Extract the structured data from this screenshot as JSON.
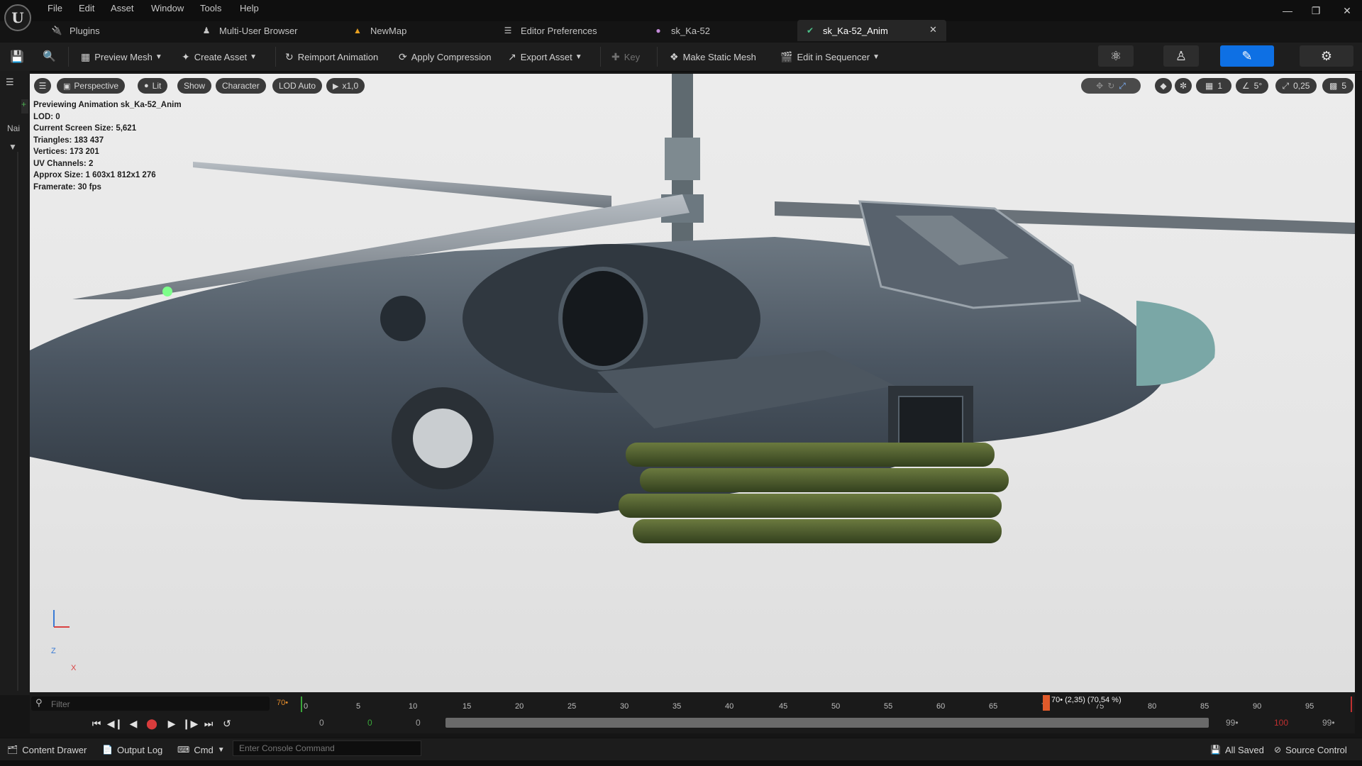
{
  "menu": {
    "items": [
      "File",
      "Edit",
      "Asset",
      "Window",
      "Tools",
      "Help"
    ]
  },
  "tabs": [
    {
      "label": "Plugins",
      "icon": "plug-icon"
    },
    {
      "label": "Multi-User Browser",
      "icon": "users-icon"
    },
    {
      "label": "NewMap",
      "icon": "map-icon"
    },
    {
      "label": "Editor Preferences",
      "icon": "sliders-icon"
    },
    {
      "label": "sk_Ka-52",
      "icon": "skeletal-mesh-icon"
    },
    {
      "label": "sk_Ka-52_Anim",
      "icon": "animation-icon",
      "active": true
    }
  ],
  "toolbar": {
    "preview_mesh": "Preview Mesh",
    "create_asset": "Create Asset",
    "reimport": "Reimport Animation",
    "apply_compression": "Apply Compression",
    "export_asset": "Export Asset",
    "key": "Key",
    "make_static_mesh": "Make Static Mesh",
    "edit_in_sequencer": "Edit in Sequencer"
  },
  "viewport": {
    "buttons": {
      "perspective": "Perspective",
      "lit": "Lit",
      "show": "Show",
      "character": "Character",
      "lod": "LOD Auto",
      "speed": "x1,0"
    },
    "right_controls": {
      "grid": "1",
      "angle": "5°",
      "scale": "0,25",
      "camera_speed": "5"
    },
    "stats": [
      "Previewing Animation sk_Ka-52_Anim",
      "LOD: 0",
      "Current Screen Size: 5,621",
      "Triangles: 183 437",
      "Vertices: 173 201",
      "UV Channels: 2",
      "Approx Size: 1 603x1 812x1 276",
      "Framerate: 30 fps"
    ],
    "axis": {
      "z": "Z",
      "x": "X"
    },
    "left_tab": "Nai"
  },
  "timeline": {
    "filter_placeholder": "Filter",
    "frame_indicator": "70•",
    "ticks": [
      "0",
      "5",
      "10",
      "15",
      "20",
      "25",
      "30",
      "35",
      "40",
      "45",
      "50",
      "55",
      "60",
      "65",
      "70",
      "75",
      "80",
      "85",
      "90",
      "95"
    ],
    "playhead_label": "70• (2,35) (70,54 %)",
    "start_values": [
      "0",
      "0",
      "0"
    ],
    "end_values": [
      "99•",
      "100",
      "99•"
    ]
  },
  "statusbar": {
    "content_drawer": "Content Drawer",
    "output_log": "Output Log",
    "cmd": "Cmd",
    "console_placeholder": "Enter Console Command",
    "all_saved": "All Saved",
    "source_control": "Source Control"
  },
  "colors": {
    "accent": "#0e70e4",
    "playhead": "#e05a2a",
    "bg": "#1e1e1e",
    "viewport_bg": "#e9e9e9",
    "fuselage": "#3f4a55",
    "canopy": "#5a6470",
    "pods": "#4f5a32"
  }
}
